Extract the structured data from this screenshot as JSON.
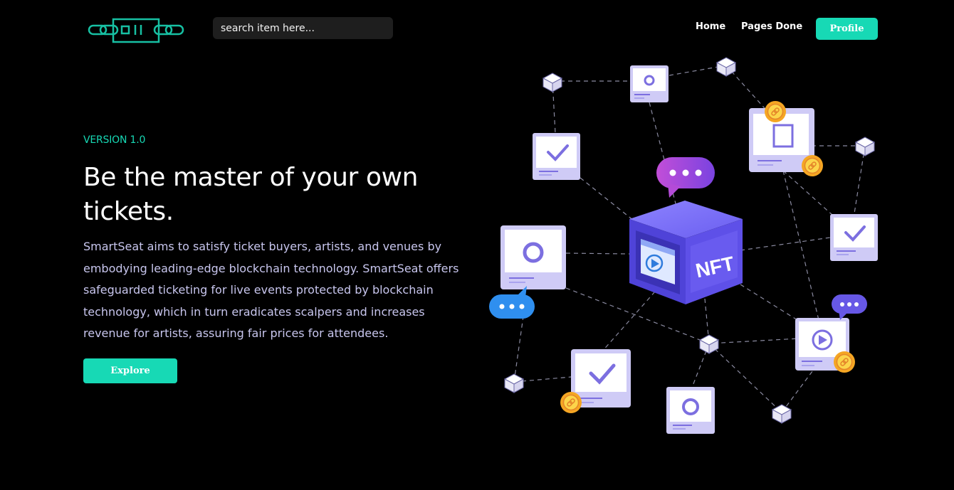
{
  "header": {
    "search": {
      "placeholder": "search item here..."
    },
    "nav": {
      "home": "Home",
      "pages_done": "Pages Done"
    },
    "profile_label": "Profile"
  },
  "hero": {
    "version": "VERSION 1.0",
    "headline": "Be the master of your own tickets.",
    "description": "SmartSeat aims to satisfy ticket buyers, artists, and venues by embodying leading-edge blockchain technology. SmartSeat offers safeguarded ticketing for live events protected by blockchain technology, which in turn eradicates scalpers and increases revenue for artists, assuring fair prices for attendees.",
    "explore_label": "Explore"
  },
  "illustration": {
    "cube_label": "NFT"
  },
  "colors": {
    "accent": "#17d9b5",
    "background": "#000000",
    "description_text": "#c8c6ee",
    "card": "#e2e0fb",
    "card_icon": "#7c6fe0",
    "cube": "#5b4ee0",
    "bubble_purple": "#a44bd8",
    "bubble_blue": "#2f8fef",
    "coin": "#f5a623"
  }
}
